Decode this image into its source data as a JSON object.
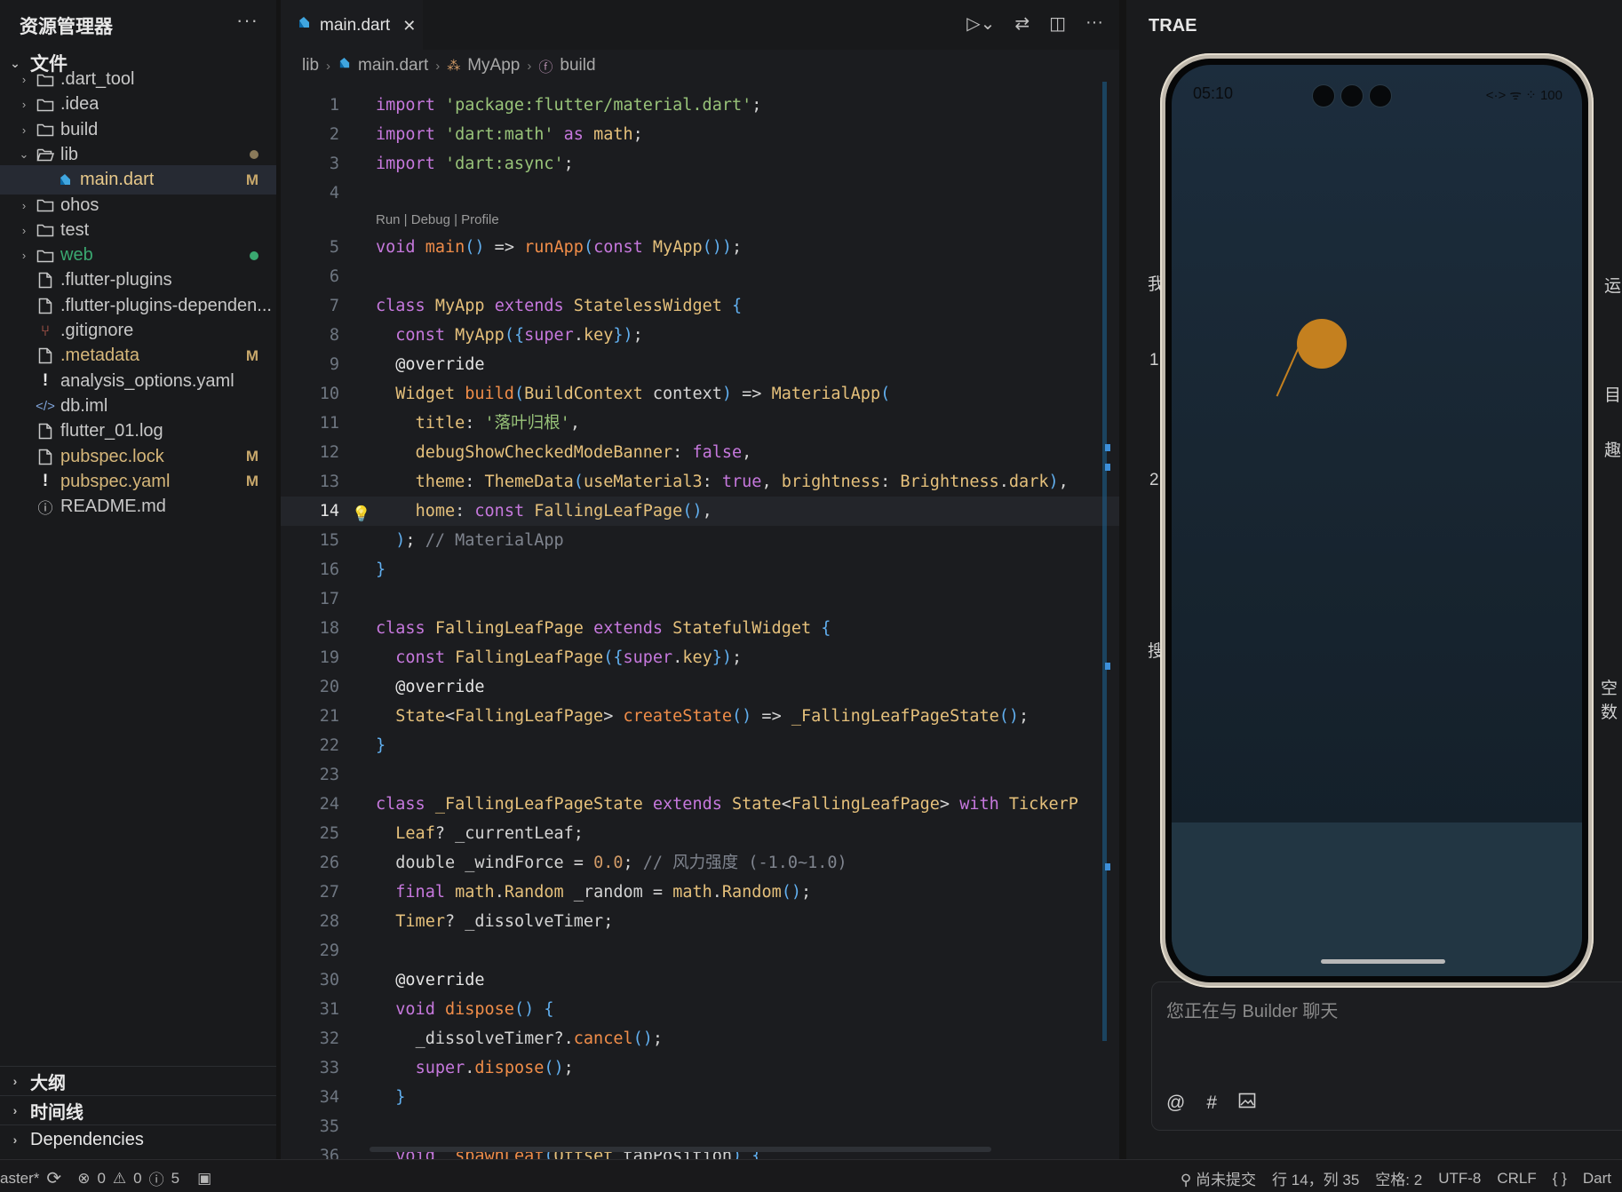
{
  "explorer": {
    "title": "资源管理器",
    "more": "···",
    "root_label": "文件",
    "items": [
      {
        "label": ".dart_tool",
        "kind": "folder"
      },
      {
        "label": ".idea",
        "kind": "folder"
      },
      {
        "label": "build",
        "kind": "folder"
      },
      {
        "label": "lib",
        "kind": "folder-open"
      },
      {
        "label": "main.dart",
        "kind": "dart",
        "status": "M"
      },
      {
        "label": "ohos",
        "kind": "folder"
      },
      {
        "label": "test",
        "kind": "folder"
      },
      {
        "label": "web",
        "kind": "folder"
      },
      {
        "label": ".flutter-plugins",
        "kind": "file"
      },
      {
        "label": ".flutter-plugins-dependen...",
        "kind": "file"
      },
      {
        "label": ".gitignore",
        "kind": "git"
      },
      {
        "label": ".metadata",
        "kind": "file",
        "status": "M"
      },
      {
        "label": "analysis_options.yaml",
        "kind": "yaml"
      },
      {
        "label": "db.iml",
        "kind": "xml"
      },
      {
        "label": "flutter_01.log",
        "kind": "file"
      },
      {
        "label": "pubspec.lock",
        "kind": "file",
        "status": "M"
      },
      {
        "label": "pubspec.yaml",
        "kind": "yaml",
        "status": "M"
      },
      {
        "label": "README.md",
        "kind": "info"
      }
    ],
    "bottom_sections": [
      "大纲",
      "时间线",
      "Dependencies"
    ],
    "colors": {
      "modified": "#c8a86b",
      "selected_bg": "#262a33",
      "web_green": "#3aa870"
    }
  },
  "editor": {
    "tab": {
      "label": "main.dart",
      "close": "✕"
    },
    "breadcrumb": [
      "lib",
      "main.dart",
      "MyApp",
      "build"
    ],
    "codelens": "Run | Debug | Profile",
    "current_line": 14,
    "lines": [
      "import 'package:flutter/material.dart';",
      "import 'dart:math' as math;",
      "import 'dart:async';",
      "",
      "void main() => runApp(const MyApp());",
      "",
      "class MyApp extends StatelessWidget {",
      "  const MyApp({super.key});",
      "  @override",
      "  Widget build(BuildContext context) => MaterialApp(",
      "    title: '落叶归根',",
      "    debugShowCheckedModeBanner: false,",
      "    theme: ThemeData(useMaterial3: true, brightness: Brightness.dark),",
      "    home: const FallingLeafPage(),",
      "  ); // MaterialApp",
      "}",
      "",
      "class FallingLeafPage extends StatefulWidget {",
      "  const FallingLeafPage({super.key});",
      "  @override",
      "  State<FallingLeafPage> createState() => _FallingLeafPageState();",
      "}",
      "",
      "class _FallingLeafPageState extends State<FallingLeafPage> with TickerP",
      "  Leaf? _currentLeaf;",
      "  double _windForce = 0.0; // 风力强度 (-1.0~1.0)",
      "  final math.Random _random = math.Random();",
      "  Timer? _dissolveTimer;",
      "",
      "  @override",
      "  void dispose() {",
      "    _dissolveTimer?.cancel();",
      "    super.dispose();",
      "  }",
      "",
      "  void _spawnLeaf(Offset tapPosition) {"
    ]
  },
  "right_panel": {
    "title": "TRAE",
    "phone": {
      "time": "05:10",
      "status_icons": "<·> ᯤ ⁘ 100",
      "sun_color": "#c4801f"
    },
    "chat": {
      "placeholder": "您正在与 Builder 聊天",
      "tools": [
        "@",
        "#",
        "🖼"
      ]
    },
    "peek_right": [
      "运",
      "目",
      "趣",
      "空数"
    ],
    "peek_left": [
      "我",
      "1",
      "2",
      "搜"
    ]
  },
  "statusbar": {
    "branch": "aster*",
    "errors": "0",
    "warnings": "0",
    "infos": "5",
    "commit": "尚未提交",
    "position": "行 14，列 35",
    "spaces": "空格: 2",
    "encoding": "UTF-8",
    "eol": "CRLF",
    "braces": "{ }",
    "language": "Dart"
  }
}
